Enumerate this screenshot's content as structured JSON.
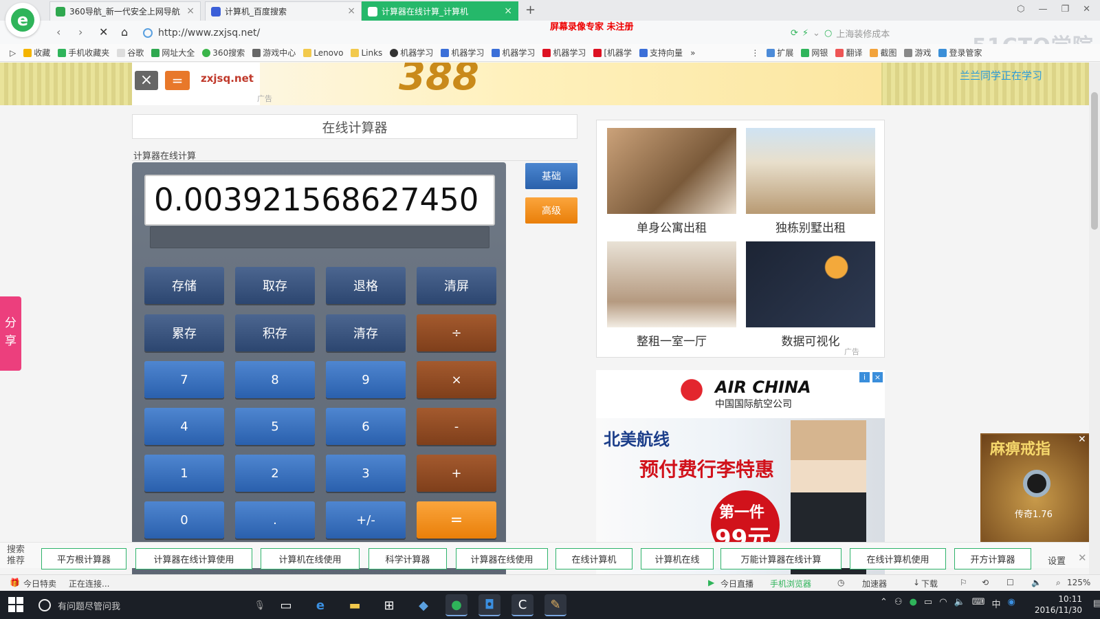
{
  "browser": {
    "tabs": [
      {
        "title": "360导航_新一代安全上网导航",
        "active": false
      },
      {
        "title": "计算机_百度搜索",
        "active": false
      },
      {
        "title": "计算器在线计算_计算机",
        "active": true
      }
    ],
    "new_tab_icon": "plus-icon",
    "recorder_mark": "屏幕录像专家  未注册",
    "url": "http://www.zxjsq.net/",
    "search_hint": "上海装修成本",
    "watermark": "51CTO学院",
    "bookmarks": [
      "收藏",
      "手机收藏夹",
      "谷歌",
      "网址大全",
      "360搜索",
      "游戏中心",
      "Lenovo",
      "Links",
      "机器学习",
      "机器学习",
      "机器学习",
      "机器学习",
      "[机器学",
      "支持向量"
    ],
    "bookmarks_right": [
      "扩展",
      "网银",
      "翻译",
      "截图",
      "游戏",
      "登录管家"
    ]
  },
  "banner": {
    "site_name": "zxjsq.net",
    "ad_big_text": "388",
    "ad_tag": "广告",
    "study_notice": "兰兰同学正在学习"
  },
  "calculator": {
    "page_title": "在线计算器",
    "subtitle": "计算器在线计算",
    "display_value": "0.003921568627450",
    "mode_basic": "基础",
    "mode_advanced": "高级",
    "keys": [
      {
        "label": "存储",
        "style": "dark"
      },
      {
        "label": "取存",
        "style": "dark"
      },
      {
        "label": "退格",
        "style": "dark"
      },
      {
        "label": "清屏",
        "style": "dark"
      },
      {
        "label": "累存",
        "style": "dark"
      },
      {
        "label": "积存",
        "style": "dark"
      },
      {
        "label": "清存",
        "style": "dark"
      },
      {
        "label": "÷",
        "style": "brown"
      },
      {
        "label": "7",
        "style": "blue"
      },
      {
        "label": "8",
        "style": "blue"
      },
      {
        "label": "9",
        "style": "blue"
      },
      {
        "label": "×",
        "style": "brown"
      },
      {
        "label": "4",
        "style": "blue"
      },
      {
        "label": "5",
        "style": "blue"
      },
      {
        "label": "6",
        "style": "blue"
      },
      {
        "label": "-",
        "style": "brown"
      },
      {
        "label": "1",
        "style": "blue"
      },
      {
        "label": "2",
        "style": "blue"
      },
      {
        "label": "3",
        "style": "blue"
      },
      {
        "label": "+",
        "style": "brown"
      },
      {
        "label": "0",
        "style": "blue"
      },
      {
        "label": ".",
        "style": "blue"
      },
      {
        "label": "+/-",
        "style": "blue"
      },
      {
        "label": "=",
        "style": "orange"
      }
    ]
  },
  "share": {
    "label1": "分",
    "label2": "享"
  },
  "rentals": [
    {
      "label": "单身公寓出租"
    },
    {
      "label": "独栋别墅出租"
    },
    {
      "label": "整租一室一厅"
    },
    {
      "label": "数据可视化"
    }
  ],
  "rent_ad_tag": "广告",
  "air_china": {
    "brand": "AIR CHINA",
    "brand_cn": "中国国际航空公司",
    "headline": "北美航线",
    "subhead": "预付费行李特惠",
    "circle_top": "第一件",
    "circle_price": "99元"
  },
  "game_ad": {
    "title": "麻痹戒指",
    "sub": "传奇1.76"
  },
  "search_recommend": {
    "label": "搜索推荐",
    "items": [
      "平方根计算器",
      "计算器在线计算使用",
      "计算机在线使用",
      "科学计算器",
      "计算器在线使用",
      "在线计算机",
      "计算机在线",
      "万能计算器在线计算",
      "在线计算机使用",
      "开方计算器"
    ],
    "settings": "设置"
  },
  "statusbar": {
    "deals": "今日特卖",
    "connecting": "正在连接...",
    "live": "今日直播",
    "mobile": "手机浏览器",
    "accel": "加速器",
    "download": "下载",
    "zoom": "125%"
  },
  "taskbar": {
    "search_placeholder": "有问题尽管问我",
    "time": "10:11",
    "date": "2016/11/30",
    "ime": "中"
  },
  "colors": {
    "active_tab": "#25b86a",
    "calc_body": "#66707d",
    "key_blue": "#3a70bd",
    "key_brown": "#8f4b24",
    "key_orange": "#f28d1f",
    "share_pink": "#ec3f7d"
  }
}
